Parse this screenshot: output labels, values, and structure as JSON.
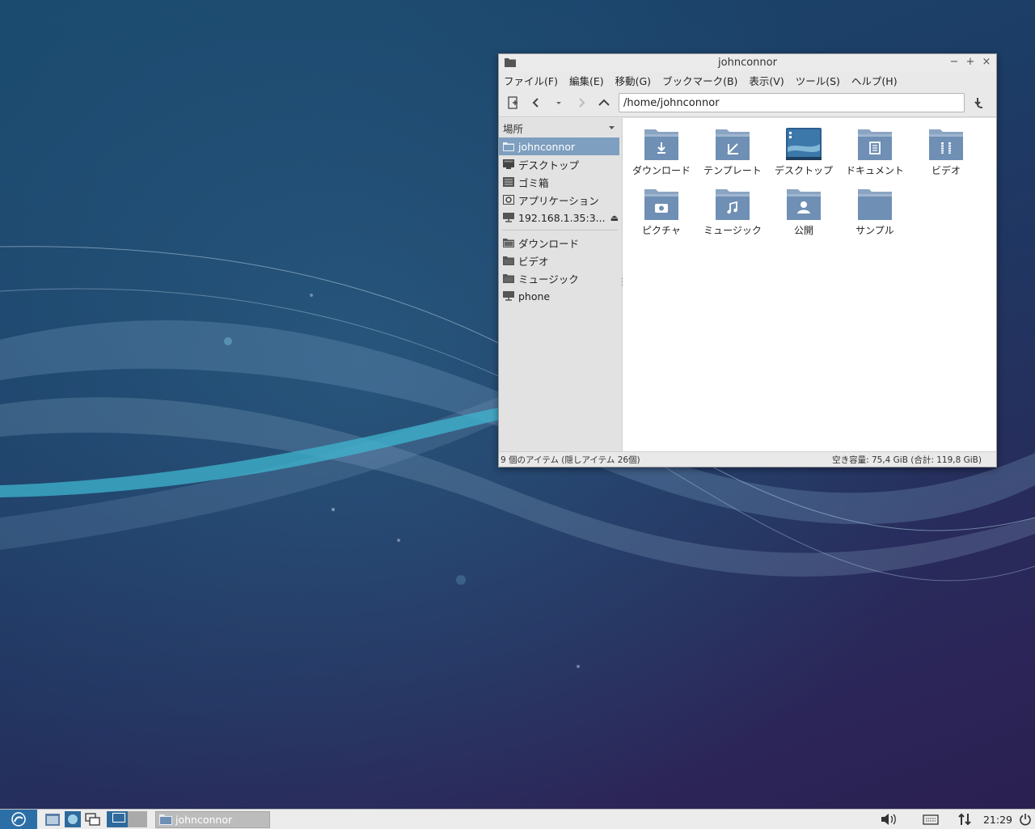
{
  "window": {
    "title": "johnconnor",
    "controls": {
      "minimize": "−",
      "maximize": "+",
      "close": "×"
    }
  },
  "menubar": [
    "ファイル(F)",
    "編集(E)",
    "移動(G)",
    "ブックマーク(B)",
    "表示(V)",
    "ツール(S)",
    "ヘルプ(H)"
  ],
  "toolbar": {
    "address": "/home/johnconnor"
  },
  "sidebar": {
    "header": "場所",
    "places": [
      {
        "label": "johnconnor",
        "icon": "folder-icon",
        "selected": true
      },
      {
        "label": "デスクトップ",
        "icon": "desktop-icon"
      },
      {
        "label": "ゴミ箱",
        "icon": "trash-icon"
      },
      {
        "label": "アプリケーション",
        "icon": "applications-icon"
      },
      {
        "label": "192.168.1.35:3...",
        "icon": "network-drive-icon",
        "eject": "⏏"
      }
    ],
    "bookmarks": [
      {
        "label": "ダウンロード",
        "icon": "folder-icon"
      },
      {
        "label": "ビデオ",
        "icon": "folder-icon"
      },
      {
        "label": "ミュージック",
        "icon": "folder-icon"
      },
      {
        "label": "phone",
        "icon": "network-drive-icon"
      }
    ]
  },
  "files": [
    {
      "label": "ダウンロード",
      "emblem": "download-emblem"
    },
    {
      "label": "テンプレート",
      "emblem": "template-emblem"
    },
    {
      "label": "デスクトップ",
      "emblem": "desktop-emblem"
    },
    {
      "label": "ドキュメント",
      "emblem": "document-emblem"
    },
    {
      "label": "ビデオ",
      "emblem": "video-emblem"
    },
    {
      "label": "ピクチャ",
      "emblem": "picture-emblem"
    },
    {
      "label": "ミュージック",
      "emblem": "music-emblem"
    },
    {
      "label": "公開",
      "emblem": "public-emblem"
    },
    {
      "label": "サンプル",
      "emblem": "none"
    }
  ],
  "statusbar": {
    "left": "9 個のアイテム (隠しアイテム 26個)",
    "right": "空き容量: 75,4 GiB (合計: 119,8 GiB)"
  },
  "taskbar": {
    "task_label": "johnconnor",
    "clock": "21:29"
  },
  "colors": {
    "selection": "#7e9fbf",
    "folder": "#6f8fb4",
    "start_button": "#2c6fa6"
  }
}
